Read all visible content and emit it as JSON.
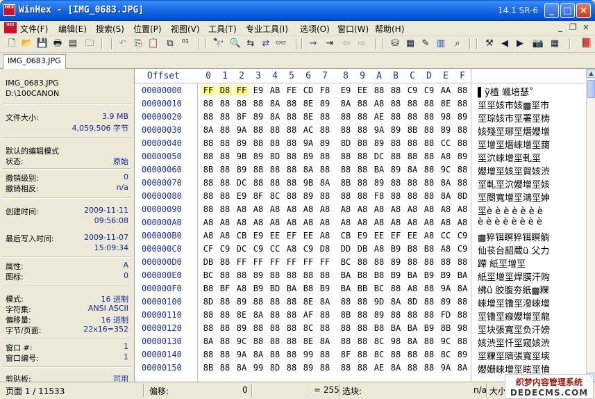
{
  "title_bar": {
    "logo_text": "HEX",
    "title": "WinHex - [IMG_0683.JPG]",
    "version": "14.1 SR-6",
    "minimize": "_",
    "maximize": "□",
    "close": "×"
  },
  "menu_bar": {
    "items": [
      "文件(F)",
      "编辑(E)",
      "搜索(S)",
      "位置(P)",
      "视图(V)",
      "工具(T)",
      "专业工具(I)",
      "选项(O)",
      "窗口(W)",
      "帮助(H)"
    ],
    "mdi_minimize": "_",
    "mdi_restore": "❐",
    "mdi_close": "×"
  },
  "toolbar": {
    "icons": [
      {
        "name": "new-file-icon",
        "glyph": "🗋",
        "style": ""
      },
      {
        "name": "open-folder-icon",
        "glyph": "📂",
        "style": ""
      },
      {
        "name": "save-icon",
        "glyph": "💾",
        "style": ""
      },
      {
        "name": "print-icon",
        "glyph": "🖶",
        "style": ""
      },
      {
        "name": "properties-icon",
        "glyph": "▤",
        "style": ""
      },
      {
        "name": "open-disk-icon",
        "glyph": "🗀",
        "style": ""
      },
      {
        "name": "undo-icon",
        "glyph": "↶",
        "style": "dim"
      },
      {
        "name": "copy-icon",
        "glyph": "⎘",
        "style": ""
      },
      {
        "name": "paste-icon",
        "glyph": "📋",
        "style": ""
      },
      {
        "name": "copy-block-icon",
        "glyph": "⧉",
        "style": ""
      },
      {
        "name": "binary-icon",
        "glyph": "⁰¹",
        "style": ""
      },
      {
        "name": "find-text-icon",
        "glyph": "🔭",
        "style": ""
      },
      {
        "name": "find-hex-icon",
        "glyph": "🔍",
        "style": "blue"
      },
      {
        "name": "replace-text-icon",
        "glyph": "⇆",
        "style": ""
      },
      {
        "name": "replace-hex-icon",
        "glyph": "⇄",
        "style": "blue"
      },
      {
        "name": "find-again-icon",
        "glyph": "👓",
        "style": ""
      },
      {
        "name": "goto-offset-icon",
        "glyph": "→",
        "style": "blue"
      },
      {
        "name": "goto-page-icon",
        "glyph": "⇥",
        "style": ""
      },
      {
        "name": "back-icon",
        "glyph": "⇦",
        "style": "dim"
      },
      {
        "name": "forward-icon",
        "glyph": "⇨",
        "style": "dim"
      },
      {
        "name": "disk-editor-icon",
        "glyph": "⛁",
        "style": ""
      },
      {
        "name": "ram-editor-icon",
        "glyph": "▦",
        "style": ""
      },
      {
        "name": "eraser-icon",
        "glyph": "✎",
        "style": ""
      },
      {
        "name": "calculator-icon",
        "glyph": "▥",
        "style": "blue"
      },
      {
        "name": "magnifier-icon",
        "glyph": "⌕",
        "style": ""
      },
      {
        "name": "gallery-icon",
        "glyph": "⚒",
        "style": ""
      },
      {
        "name": "prev-icon",
        "glyph": "◀",
        "style": ""
      },
      {
        "name": "next-icon",
        "glyph": "▶",
        "style": ""
      },
      {
        "name": "camera-icon",
        "glyph": "📷",
        "style": "dim"
      },
      {
        "name": "calendar-icon",
        "glyph": "▦",
        "style": ""
      },
      {
        "name": "help-book-icon",
        "glyph": "📕",
        "style": ""
      }
    ]
  },
  "tab": {
    "label": "IMG_0683.JPG"
  },
  "info_panel": {
    "file_name": "IMG_0683.JPG",
    "folder": "D:\\100CANON",
    "file_size_label": "文件大小:",
    "file_size_mb": "3.9 MB",
    "file_size_bytes": "4,059,506 字节",
    "edit_mode_label": "默认的编辑模式",
    "state_label": "状态:",
    "state_value": "原始",
    "undo_level_label": "撤销级别:",
    "undo_level_value": "0",
    "undo_reverse_label": "撤销相反:",
    "undo_reverse_value": "n/a",
    "created_label": "创建时间:",
    "created_date": "2009-11-11",
    "created_time": "09:56:08",
    "written_label": "最后写入时间:",
    "written_date": "2009-11-07",
    "written_time": "15:09:34",
    "attr_label": "属性:",
    "attr_value": "A",
    "icon_label": "图标:",
    "icon_value": "0",
    "mode_label": "模式:",
    "mode_value": "16 进制",
    "charset_label": "字符集:",
    "charset_value": "ANSI ASCII",
    "offset_label": "偏移量:",
    "offset_value": "16 进制",
    "bpp_label": "字节/页面:",
    "bpp_value": "22x16=352",
    "window_num_label": "窗口 #:",
    "window_num_value": "1",
    "window_id_label": "窗口编号:",
    "window_id_value": "1",
    "clipboard_label": "剪贴板:",
    "clipboard_value": "可用"
  },
  "hex_view": {
    "offset_header": "Offset",
    "column_headers": [
      "0",
      "1",
      "2",
      "3",
      "4",
      "5",
      "6",
      "7",
      "8",
      "9",
      "A",
      "B",
      "C",
      "D",
      "E",
      "F"
    ],
    "rows": [
      {
        "offset": "00000000",
        "bytes": [
          "FF",
          "D8",
          "FF",
          "E9",
          "AB",
          "FE",
          "CD",
          "F8",
          "E9",
          "EE",
          "88",
          "88",
          "C9",
          "C9",
          "AA",
          "88"
        ],
        "text": "▌ÿ楂   颯培瑟˚"
      },
      {
        "offset": "00000010",
        "bytes": [
          "88",
          "88",
          "88",
          "88",
          "8A",
          "88",
          "8E",
          "89",
          "8A",
          "88",
          "A8",
          "88",
          "88",
          "88",
          "8E",
          "88"
        ],
        "text": "坙坙姟市姟▩坙市"
      },
      {
        "offset": "00000020",
        "bytes": [
          "88",
          "88",
          "8F",
          "89",
          "8A",
          "88",
          "8E",
          "88",
          "88",
          "88",
          "AE",
          "88",
          "88",
          "88",
          "98",
          "89"
        ],
        "text": "坙琮姟市坙署坙梼"
      },
      {
        "offset": "00000030",
        "bytes": [
          "8A",
          "88",
          "9A",
          "88",
          "88",
          "88",
          "AC",
          "88",
          "88",
          "88",
          "9A",
          "89",
          "8B",
          "88",
          "89",
          "88"
        ],
        "text": "姟殘坙琊坙熸孆增"
      },
      {
        "offset": "00000040",
        "bytes": [
          "88",
          "88",
          "89",
          "88",
          "88",
          "88",
          "9A",
          "89",
          "8D",
          "88",
          "89",
          "88",
          "88",
          "88",
          "CC",
          "88"
        ],
        "text": "坙增坙熸崍增坙藹"
      },
      {
        "offset": "00000050",
        "bytes": [
          "88",
          "88",
          "9B",
          "89",
          "8D",
          "88",
          "89",
          "88",
          "88",
          "88",
          "DC",
          "88",
          "88",
          "88",
          "A8",
          "89"
        ],
        "text": "坙泬崍增坙軋坙"
      },
      {
        "offset": "00000060",
        "bytes": [
          "8B",
          "88",
          "89",
          "88",
          "88",
          "88",
          "8A",
          "88",
          "88",
          "88",
          "BA",
          "89",
          "8A",
          "88",
          "9C",
          "88"
        ],
        "text": "孆增坙姟坙賀姟渋"
      },
      {
        "offset": "00000070",
        "bytes": [
          "88",
          "88",
          "DC",
          "88",
          "88",
          "88",
          "9B",
          "8A",
          "8B",
          "88",
          "89",
          "88",
          "88",
          "88",
          "8A",
          "88"
        ],
        "text": "坙軋坙泬孆增坙姟"
      },
      {
        "offset": "00000080",
        "bytes": [
          "88",
          "88",
          "E9",
          "8F",
          "8C",
          "88",
          "89",
          "88",
          "88",
          "88",
          "F8",
          "88",
          "88",
          "88",
          "8A",
          "8D"
        ],
        "text": "坙閿寬增坙鴻坙妽"
      },
      {
        "offset": "00000090",
        "bytes": [
          "88",
          "88",
          "A8",
          "A8",
          "A8",
          "A8",
          "A8",
          "A8",
          "A8",
          "A8",
          "A8",
          "A8",
          "A8",
          "A8",
          "A8",
          "A8"
        ],
        "text": "坙è è è è è è è"
      },
      {
        "offset": "000000A0",
        "bytes": [
          "A8",
          "A8",
          "A8",
          "A8",
          "A8",
          "A8",
          "A8",
          "A8",
          "A8",
          "A8",
          "A8",
          "A8",
          "A8",
          "A8",
          "A8",
          "A8"
        ],
        "text": "è è è è è è è è"
      },
      {
        "offset": "000000B0",
        "bytes": [
          "A8",
          "A8",
          "CB",
          "E9",
          "EE",
          "EF",
          "EE",
          "A8",
          "CB",
          "E9",
          "EE",
          "EF",
          "EE",
          "A8",
          "CC",
          "C9"
        ],
        "text": "▩猝铒瞑猝铒瞑躺"
      },
      {
        "offset": "000000C0",
        "bytes": [
          "CF",
          "C9",
          "DC",
          "C9",
          "CC",
          "A8",
          "C9",
          "D8",
          "DD",
          "DB",
          "A8",
          "B9",
          "B8",
          "B8",
          "A8",
          "C9"
        ],
        "text": "仙苌台韶葳ü 父力"
      },
      {
        "offset": "000000D0",
        "bytes": [
          "DB",
          "88",
          "FF",
          "FF",
          "FF",
          "FF",
          "FF",
          "FF",
          "BC",
          "88",
          "88",
          "89",
          "88",
          "88",
          "88",
          "88"
        ],
        "text": "蹛      紙坙增坙"
      },
      {
        "offset": "000000E0",
        "bytes": [
          "BC",
          "88",
          "88",
          "89",
          "88",
          "88",
          "88",
          "88",
          "BA",
          "B8",
          "B8",
          "B9",
          "BA",
          "B9",
          "B9",
          "BA"
        ],
        "text": "紙坙增坙焊膜汗购"
      },
      {
        "offset": "000000F0",
        "bytes": [
          "B8",
          "BF",
          "A8",
          "B9",
          "BD",
          "BA",
          "B8",
          "B9",
          "BA",
          "BB",
          "BC",
          "88",
          "A8",
          "88",
          "9A",
          "8A"
        ],
        "text": "绋ü 胶腹夯紙▩粿"
      },
      {
        "offset": "00000100",
        "bytes": [
          "8D",
          "88",
          "89",
          "88",
          "88",
          "88",
          "8E",
          "8A",
          "88",
          "88",
          "9D",
          "8A",
          "8D",
          "88",
          "89",
          "88"
        ],
        "text": "崍增坙镥坙潑崍增"
      },
      {
        "offset": "00000110",
        "bytes": [
          "88",
          "88",
          "8E",
          "8A",
          "88",
          "88",
          "AF",
          "88",
          "8B",
          "88",
          "89",
          "88",
          "88",
          "88",
          "FD",
          "88"
        ],
        "text": "坙镥坙瘊孆增坙龍"
      },
      {
        "offset": "00000120",
        "bytes": [
          "88",
          "88",
          "89",
          "88",
          "88",
          "88",
          "8C",
          "88",
          "88",
          "88",
          "B8",
          "BA",
          "BA",
          "B9",
          "8B",
          "98"
        ],
        "text": "坙块張寬坙负汗嫎"
      },
      {
        "offset": "00000130",
        "bytes": [
          "8A",
          "88",
          "9C",
          "88",
          "88",
          "88",
          "8E",
          "8A",
          "88",
          "88",
          "8C",
          "98",
          "8A",
          "88",
          "9C",
          "88"
        ],
        "text": "姟渋坙忏坙窥姟渋"
      },
      {
        "offset": "00000140",
        "bytes": [
          "88",
          "88",
          "9A",
          "8A",
          "88",
          "88",
          "99",
          "88",
          "8F",
          "88",
          "8C",
          "88",
          "88",
          "88",
          "8C",
          "89"
        ],
        "text": "坙粿坙隮張寬坙塽"
      },
      {
        "offset": "00000150",
        "bytes": [
          "8B",
          "88",
          "8A",
          "99",
          "8D",
          "88",
          "89",
          "88",
          "88",
          "88",
          "AE",
          "8A",
          "88",
          "88",
          "9A",
          "8A"
        ],
        "text": "孆姗崍增坙眩坙憤"
      }
    ]
  },
  "status_bar": {
    "page": "页面 1 / 11533",
    "offset_label": "偏移:",
    "offset_value": "0",
    "equals": "= 255",
    "selection_label": "选块:",
    "na": "n/a",
    "size_label": "大小:"
  },
  "watermark": {
    "line1": "织梦内容管理系统",
    "line2": "DEDECMS.COM"
  }
}
